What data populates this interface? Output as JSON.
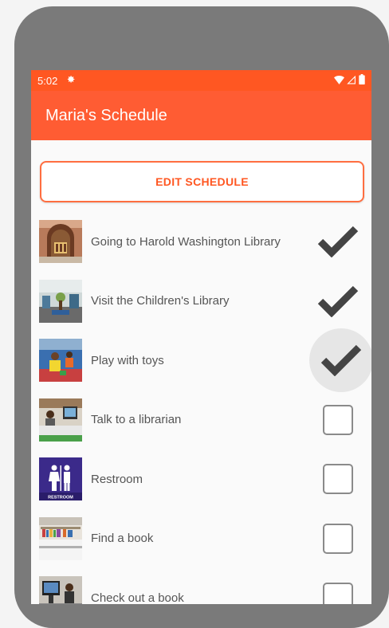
{
  "status_bar": {
    "time": "5:02",
    "icons": [
      "settings-gear-icon",
      "wifi-icon",
      "signal-icon",
      "battery-icon"
    ]
  },
  "app_bar": {
    "title": "Maria's Schedule"
  },
  "edit_button": {
    "label": "EDIT SCHEDULE"
  },
  "colors": {
    "accent": "#ff5722",
    "app_bar": "#ff5c33",
    "frame": "#7a7a7a"
  },
  "schedule": [
    {
      "label": "Going to Harold Washington Library",
      "checked": true,
      "image": "library-entrance-photo"
    },
    {
      "label": "Visit the Children's Library",
      "checked": true,
      "image": "childrens-library-photo"
    },
    {
      "label": "Play with toys",
      "checked": true,
      "image": "kids-playing-photo"
    },
    {
      "label": "Talk to a librarian",
      "checked": false,
      "image": "librarian-desk-photo"
    },
    {
      "label": "Restroom",
      "checked": false,
      "image": "restroom-sign",
      "image_caption": "RESTROOM"
    },
    {
      "label": "Find a book",
      "checked": false,
      "image": "bookshelf-photo"
    },
    {
      "label": "Check out a book",
      "checked": false,
      "image": "checkout-station-photo"
    }
  ]
}
